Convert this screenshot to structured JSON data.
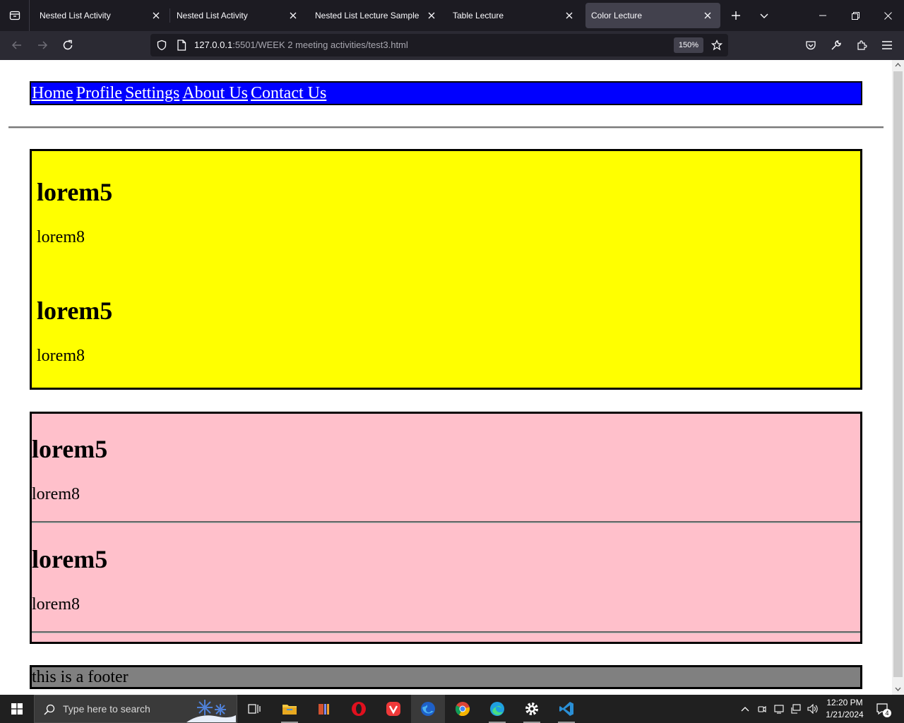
{
  "browser": {
    "tabs": [
      {
        "title": "Nested List Activity",
        "active": false
      },
      {
        "title": "Nested List Activity",
        "active": false
      },
      {
        "title": "Nested List Lecture Sample",
        "active": false
      },
      {
        "title": "Table Lecture",
        "active": false
      },
      {
        "title": "Color Lecture",
        "active": true
      }
    ],
    "url_host": "127.0.0.1",
    "url_rest": ":5501/WEEK 2 meeting activities/test3.html",
    "zoom": "150%"
  },
  "page": {
    "nav_links": [
      "Home",
      "Profile",
      "Settings",
      "About Us",
      "Contact Us"
    ],
    "colors": {
      "nav_bg": "#0000ff",
      "section1_bg": "#ffff00",
      "section2_bg": "#ffc0cb",
      "footer_bg": "#808080"
    },
    "section1": [
      {
        "heading": "lorem5",
        "text": "lorem8"
      },
      {
        "heading": "lorem5",
        "text": "lorem8"
      }
    ],
    "section2": [
      {
        "heading": "lorem5",
        "text": "lorem8"
      },
      {
        "heading": "lorem5",
        "text": "lorem8"
      }
    ],
    "footer": "this is a footer"
  },
  "taskbar": {
    "search_placeholder": "Type here to search",
    "time": "12:20 PM",
    "date": "1/21/2024",
    "notification_count": "4",
    "apps": [
      "task-view",
      "file-explorer",
      "office",
      "opera",
      "vivaldi",
      "firefox",
      "chrome",
      "edge",
      "settings",
      "vscode"
    ]
  }
}
